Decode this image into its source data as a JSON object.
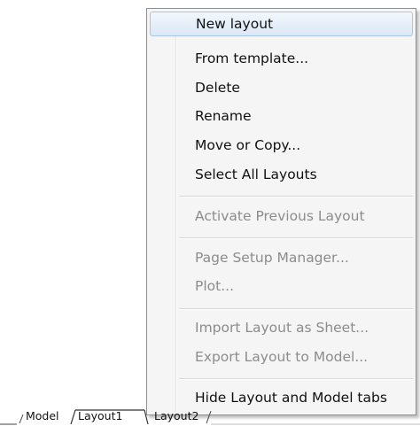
{
  "context_menu": {
    "items": [
      {
        "label": "New layout",
        "enabled": true,
        "highlighted": true
      },
      {
        "label": "From template...",
        "enabled": true
      },
      {
        "label": "Delete",
        "enabled": true
      },
      {
        "label": "Rename",
        "enabled": true
      },
      {
        "label": "Move or Copy...",
        "enabled": true
      },
      {
        "label": "Select All Layouts",
        "enabled": true
      },
      {
        "label": "Activate Previous Layout",
        "enabled": false
      },
      {
        "label": "Page Setup Manager...",
        "enabled": false
      },
      {
        "label": "Plot...",
        "enabled": false
      },
      {
        "label": "Import Layout as Sheet...",
        "enabled": false
      },
      {
        "label": "Export Layout to Model...",
        "enabled": false
      },
      {
        "label": "Hide Layout and Model tabs",
        "enabled": true
      }
    ]
  },
  "tabs": [
    {
      "label": "Model"
    },
    {
      "label": "Layout1",
      "active": true
    },
    {
      "label": "Layout2"
    }
  ],
  "colors": {
    "highlight_border": "#a9c6e8",
    "disabled_text": "#8c8c8c",
    "menu_background": "#f5f5f5"
  }
}
